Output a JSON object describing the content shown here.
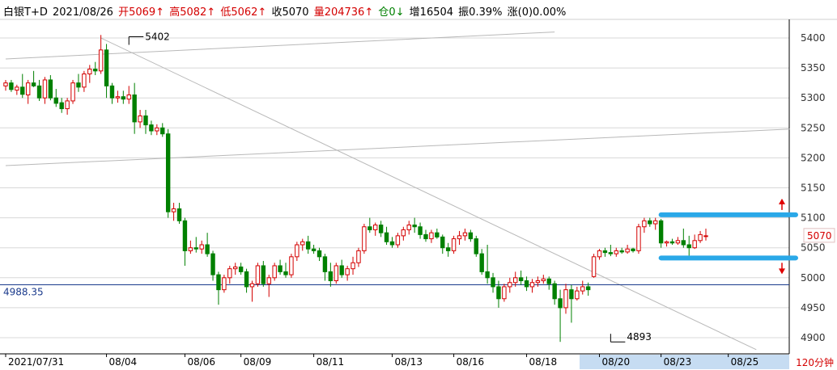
{
  "header": {
    "name": "白银T+D",
    "date": "2021/08/26",
    "open": "开5069↑",
    "high": "高5082↑",
    "low": "低5062↑",
    "close": "收5070",
    "volume": "量204736↑",
    "position": "仓0↓",
    "increase": "增16504",
    "amplitude": "振0.39%",
    "change": "涨(0)0.00%"
  },
  "timeframe": "120分钟",
  "colors": {
    "up": "#d40000",
    "down": "#008000",
    "grid": "#d8d8d8",
    "support_line": "#1a3a8c",
    "range_box": "#2aa8e8",
    "arrow": "#e00000",
    "price_tag": "#d40000"
  },
  "chart_data": {
    "type": "candlestick",
    "y_axis": {
      "ticks": [
        5400,
        5350,
        5300,
        5250,
        5200,
        5150,
        5100,
        5050,
        5000,
        4950,
        4900
      ],
      "range": [
        4880,
        5440
      ]
    },
    "x_axis": {
      "tick_labels": [
        "2021/07/31",
        "08/04",
        "08/06",
        "08/09",
        "08/11",
        "08/13",
        "08/16",
        "08/18",
        "08/20",
        "08/23",
        "08/25"
      ]
    },
    "annotations": {
      "high_label": "5402",
      "low_label": "4893",
      "horizontal_line_value": 4988.35,
      "horizontal_line_label": "4988.35",
      "last_price": "5070",
      "range_top": 5105,
      "range_bottom": 5033
    },
    "ohlc": [
      [
        5320,
        5330,
        5312,
        5325
      ],
      [
        5325,
        5330,
        5310,
        5314
      ],
      [
        5313,
        5322,
        5305,
        5318
      ],
      [
        5318,
        5340,
        5300,
        5306
      ],
      [
        5305,
        5330,
        5290,
        5325
      ],
      [
        5325,
        5345,
        5318,
        5320
      ],
      [
        5320,
        5330,
        5295,
        5300
      ],
      [
        5300,
        5335,
        5290,
        5330
      ],
      [
        5330,
        5338,
        5296,
        5300
      ],
      [
        5300,
        5315,
        5285,
        5291
      ],
      [
        5292,
        5300,
        5275,
        5282
      ],
      [
        5282,
        5300,
        5272,
        5295
      ],
      [
        5295,
        5330,
        5290,
        5325
      ],
      [
        5325,
        5340,
        5310,
        5318
      ],
      [
        5318,
        5345,
        5310,
        5340
      ],
      [
        5340,
        5355,
        5325,
        5348
      ],
      [
        5348,
        5360,
        5338,
        5345
      ],
      [
        5345,
        5405,
        5340,
        5380
      ],
      [
        5380,
        5390,
        5300,
        5320
      ],
      [
        5320,
        5325,
        5290,
        5300
      ],
      [
        5300,
        5312,
        5292,
        5302
      ],
      [
        5302,
        5312,
        5290,
        5298
      ],
      [
        5298,
        5320,
        5290,
        5305
      ],
      [
        5305,
        5325,
        5240,
        5260
      ],
      [
        5260,
        5280,
        5250,
        5270
      ],
      [
        5270,
        5280,
        5240,
        5255
      ],
      [
        5255,
        5262,
        5238,
        5245
      ],
      [
        5245,
        5256,
        5238,
        5250
      ],
      [
        5250,
        5258,
        5235,
        5240
      ],
      [
        5240,
        5248,
        5100,
        5110
      ],
      [
        5110,
        5125,
        5095,
        5115
      ],
      [
        5115,
        5125,
        5090,
        5095
      ],
      [
        5095,
        5100,
        5020,
        5045
      ],
      [
        5045,
        5062,
        5040,
        5050
      ],
      [
        5050,
        5068,
        5042,
        5048
      ],
      [
        5048,
        5062,
        5040,
        5055
      ],
      [
        5055,
        5075,
        5035,
        5040
      ],
      [
        5040,
        5045,
        4995,
        5005
      ],
      [
        5005,
        5010,
        4955,
        4980
      ],
      [
        4980,
        5005,
        4975,
        5000
      ],
      [
        5000,
        5020,
        4990,
        5015
      ],
      [
        5015,
        5025,
        5005,
        5018
      ],
      [
        5018,
        5025,
        5005,
        5010
      ],
      [
        5010,
        5015,
        4975,
        4985
      ],
      [
        4985,
        4995,
        4960,
        4990
      ],
      [
        4990,
        5025,
        4985,
        5020
      ],
      [
        5020,
        5028,
        4985,
        4990
      ],
      [
        4990,
        5005,
        4968,
        5000
      ],
      [
        5000,
        5025,
        4995,
        5020
      ],
      [
        5020,
        5030,
        5005,
        5010
      ],
      [
        5010,
        5025,
        5000,
        5005
      ],
      [
        5005,
        5040,
        5000,
        5035
      ],
      [
        5035,
        5060,
        5028,
        5055
      ],
      [
        5055,
        5065,
        5045,
        5060
      ],
      [
        5060,
        5070,
        5040,
        5048
      ],
      [
        5048,
        5055,
        5040,
        5045
      ],
      [
        5045,
        5050,
        5028,
        5035
      ],
      [
        5035,
        5040,
        4995,
        5010
      ],
      [
        5010,
        5025,
        4985,
        4995
      ],
      [
        4995,
        5025,
        4990,
        5020
      ],
      [
        5020,
        5030,
        5000,
        5005
      ],
      [
        5005,
        5020,
        4995,
        5015
      ],
      [
        5015,
        5035,
        5005,
        5025
      ],
      [
        5025,
        5050,
        5018,
        5045
      ],
      [
        5045,
        5090,
        5040,
        5085
      ],
      [
        5085,
        5100,
        5075,
        5080
      ],
      [
        5080,
        5092,
        5070,
        5088
      ],
      [
        5088,
        5095,
        5068,
        5075
      ],
      [
        5075,
        5085,
        5055,
        5060
      ],
      [
        5060,
        5068,
        5050,
        5055
      ],
      [
        5055,
        5075,
        5050,
        5070
      ],
      [
        5070,
        5085,
        5062,
        5080
      ],
      [
        5080,
        5095,
        5072,
        5088
      ],
      [
        5088,
        5100,
        5075,
        5085
      ],
      [
        5085,
        5092,
        5065,
        5072
      ],
      [
        5072,
        5080,
        5060,
        5065
      ],
      [
        5065,
        5080,
        5058,
        5075
      ],
      [
        5075,
        5082,
        5065,
        5068
      ],
      [
        5068,
        5072,
        5040,
        5050
      ],
      [
        5050,
        5058,
        5035,
        5045
      ],
      [
        5045,
        5070,
        5040,
        5065
      ],
      [
        5065,
        5078,
        5055,
        5070
      ],
      [
        5070,
        5082,
        5062,
        5075
      ],
      [
        5075,
        5080,
        5060,
        5065
      ],
      [
        5065,
        5070,
        5035,
        5040
      ],
      [
        5040,
        5048,
        5005,
        5010
      ],
      [
        5010,
        5055,
        4990,
        5000
      ],
      [
        5000,
        5008,
        4975,
        4985
      ],
      [
        4985,
        4995,
        4950,
        4965
      ],
      [
        4965,
        4990,
        4960,
        4985
      ],
      [
        4985,
        5000,
        4975,
        4992
      ],
      [
        4992,
        5010,
        4985,
        5000
      ],
      [
        5000,
        5012,
        4988,
        4995
      ],
      [
        4995,
        5002,
        4978,
        4985
      ],
      [
        4985,
        4998,
        4975,
        4992
      ],
      [
        4992,
        5002,
        4985,
        4995
      ],
      [
        4995,
        5005,
        4990,
        4998
      ],
      [
        4998,
        5002,
        4980,
        4990
      ],
      [
        4990,
        4995,
        4955,
        4965
      ],
      [
        4965,
        4980,
        4893,
        4950
      ],
      [
        4950,
        4990,
        4940,
        4980
      ],
      [
        4980,
        4988,
        4925,
        4965
      ],
      [
        4965,
        4985,
        4962,
        4978
      ],
      [
        4978,
        4995,
        4972,
        4985
      ],
      [
        4985,
        4992,
        4970,
        4980
      ],
      [
        5002,
        5040,
        5000,
        5035
      ],
      [
        5035,
        5048,
        5030,
        5045
      ],
      [
        5045,
        5050,
        5035,
        5042
      ],
      [
        5042,
        5055,
        5036,
        5040
      ],
      [
        5040,
        5050,
        5035,
        5045
      ],
      [
        5045,
        5050,
        5040,
        5043
      ],
      [
        5043,
        5055,
        5040,
        5048
      ],
      [
        5048,
        5050,
        5042,
        5045
      ],
      [
        5045,
        5090,
        5040,
        5085
      ],
      [
        5085,
        5100,
        5075,
        5095
      ],
      [
        5095,
        5100,
        5085,
        5090
      ],
      [
        5090,
        5100,
        5080,
        5095
      ],
      [
        5095,
        5098,
        5050,
        5058
      ],
      [
        5058,
        5062,
        5052,
        5060
      ],
      [
        5060,
        5065,
        5055,
        5058
      ],
      [
        5058,
        5068,
        5055,
        5062
      ],
      [
        5062,
        5082,
        5050,
        5055
      ],
      [
        5055,
        5070,
        5035,
        5050
      ],
      [
        5050,
        5072,
        5048,
        5062
      ],
      [
        5062,
        5078,
        5058,
        5072
      ],
      [
        5069,
        5082,
        5062,
        5070
      ]
    ],
    "trendlines": [
      {
        "from": [
          0,
          5365
        ],
        "to": [
          98,
          5410
        ]
      },
      {
        "from": [
          0,
          5187
        ],
        "to": [
          140,
          5248
        ]
      },
      {
        "from": [
          17,
          5400
        ],
        "to": [
          134,
          4880
        ]
      }
    ],
    "x_tick_positions": [
      0,
      18,
      32,
      42,
      55,
      69,
      80,
      93,
      106,
      117,
      129
    ]
  }
}
